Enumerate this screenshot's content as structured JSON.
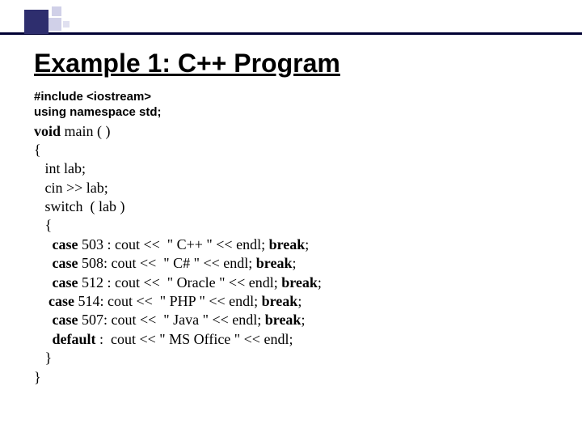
{
  "title": "Example 1: C++ Program",
  "pre": {
    "l1": "#include <iostream>",
    "l2": "using namespace std;"
  },
  "code": {
    "void": "void",
    "main_sig": " main ( )",
    "open_brace": "{",
    "int_line": "   int lab;",
    "cin_line": "   cin >> lab;",
    "switch_line": "   switch  ( lab )",
    "sw_open": "   {",
    "case_kw": "case",
    "c503_rest": " 503 : cout <<  \" C++ \" << endl; ",
    "c508_rest": " 508: cout <<  \" C# \" << endl; ",
    "c512_rest": " 512 : cout <<  \" Oracle \" << endl; ",
    "c514_rest": " 514: cout <<  \" PHP \" << endl; ",
    "c507_rest": " 507: cout <<  \" Java \" << endl; ",
    "break_kw": "break",
    "semi": ";",
    "default_kw": "default",
    "default_rest": " :  cout << \" MS Office \" << endl;",
    "sw_close": "   }",
    "close_brace": "}",
    "ind5": "     ",
    "ind4": "    "
  }
}
